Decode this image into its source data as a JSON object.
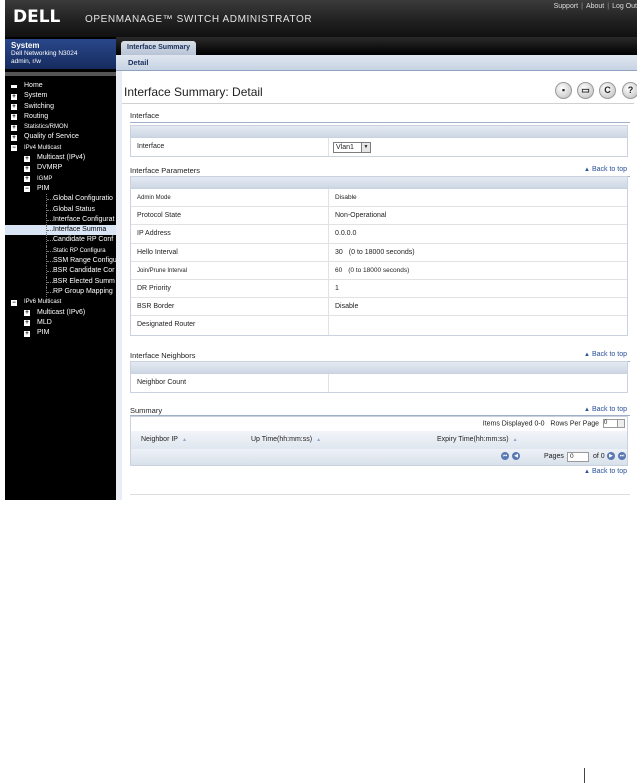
{
  "banner": {
    "logo": "DELL",
    "title": "OPENMANAGE™ SWITCH ADMINISTRATOR",
    "links": [
      "Support",
      "About",
      "Log Out"
    ]
  },
  "system": {
    "title": "System",
    "device": "Dell Networking N3024",
    "user": "admin, r/w"
  },
  "nav": {
    "items": [
      {
        "label": "Home"
      },
      {
        "label": "System"
      },
      {
        "label": "Switching"
      },
      {
        "label": "Routing"
      },
      {
        "label": "Statistics/RMON"
      },
      {
        "label": "Quality of Service"
      },
      {
        "label": "IPv4 Multicast"
      },
      {
        "label": "Multicast (IPv4)"
      },
      {
        "label": "DVMRP"
      },
      {
        "label": "IGMP"
      },
      {
        "label": "PIM"
      },
      {
        "label": "Global Configuratio"
      },
      {
        "label": "Global Status"
      },
      {
        "label": "Interface Configurat"
      },
      {
        "label": "Interface Summa"
      },
      {
        "label": "Candidate RP Conf"
      },
      {
        "label": "Static RP Configura"
      },
      {
        "label": "SSM Range Configu"
      },
      {
        "label": "BSR Candidate Cor"
      },
      {
        "label": "BSR Elected Summ"
      },
      {
        "label": "RP Group Mapping"
      },
      {
        "label": "IPv6 Multicast"
      },
      {
        "label": "Multicast (IPv6)"
      },
      {
        "label": "MLD"
      },
      {
        "label": "PIM"
      }
    ]
  },
  "tabs": {
    "main": "Interface Summary",
    "sub": "Detail"
  },
  "page": {
    "title": "Interface Summary: Detail",
    "icons": [
      "save-icon",
      "print-icon",
      "refresh-icon",
      "help-icon"
    ],
    "back_to_top": "Back to top"
  },
  "interface_section": {
    "title": "Interface",
    "label": "Interface",
    "value": "Vlan1"
  },
  "params_section": {
    "title": "Interface Parameters",
    "rows": [
      {
        "key": "Admin Mode",
        "value": "Disable",
        "range": ""
      },
      {
        "key": "Protocol State",
        "value": "Non-Operational",
        "range": ""
      },
      {
        "key": "IP Address",
        "value": "0.0.0.0",
        "range": ""
      },
      {
        "key": "Hello Interval",
        "value": "30",
        "range": "(0 to 18000 seconds)"
      },
      {
        "key": "Join/Prune Interval",
        "value": "60",
        "range": "(0 to 18000 seconds)"
      },
      {
        "key": "DR Priority",
        "value": "1",
        "range": ""
      },
      {
        "key": "BSR Border",
        "value": "Disable",
        "range": ""
      },
      {
        "key": "Designated Router",
        "value": "",
        "range": ""
      }
    ]
  },
  "neighbors_section": {
    "title": "Interface Neighbors",
    "label": "Neighbor Count",
    "value": ""
  },
  "summary_section": {
    "title": "Summary",
    "items_displayed": "Items Displayed 0-0",
    "rows_per_page_label": "Rows Per Page",
    "rows_per_page_value": "0",
    "columns": [
      "Neighbor IP",
      "Up Time(hh:mm:ss)",
      "Expiry Time(hh:mm:ss)"
    ],
    "pages_label": "Pages",
    "pages_value": "0",
    "pages_of": "of 0"
  }
}
